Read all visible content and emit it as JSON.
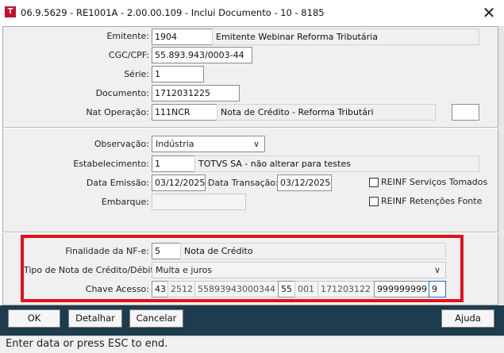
{
  "window": {
    "title": "06.9.5629 - RE1001A - 2.00.00.109 - Inclui Documento - 10 - 8185",
    "close_glyph": "✕",
    "app_icon_letter": "T"
  },
  "emitente": {
    "label": "Emitente:",
    "code": "1904",
    "name": "Emitente Webinar Reforma Tributária"
  },
  "cgc": {
    "label": "CGC/CPF:",
    "value": "55.893.943/0003-44"
  },
  "serie": {
    "label": "Série:",
    "value": "1"
  },
  "documento": {
    "label": "Documento:",
    "value": "1712031225"
  },
  "nat_operacao": {
    "label": "Nat Operação:",
    "code": "111NCR",
    "description": "Nota de Crédito - Reforma Tributári",
    "extra": ""
  },
  "observacao": {
    "label": "Observação:",
    "value": "Indústria"
  },
  "estabelecimento": {
    "label": "Estabelecimento:",
    "code": "1",
    "name": "TOTVS SA - não alterar para testes"
  },
  "data_emissao": {
    "label": "Data Emissão:",
    "value": "03/12/2025"
  },
  "data_transacao": {
    "label": "Data Transação:",
    "value": "03/12/2025"
  },
  "embarque": {
    "label": "Embarque:",
    "value": ""
  },
  "checkboxes": [
    {
      "label": "REINF Serviços Tomados",
      "checked": false
    },
    {
      "label": "REINF Retenções Fonte",
      "checked": false
    }
  ],
  "finalidade": {
    "label": "Finalidade da NF-e:",
    "code": "5",
    "description": "Nota de Crédito"
  },
  "tipo_nota": {
    "label": "Tipo de Nota de Crédito/Débito:",
    "value": "Multa e juros"
  },
  "chave_acesso": {
    "label": "Chave Acesso:",
    "parts": [
      "43",
      "2512",
      "55893943000344",
      "55",
      "001",
      "171203122",
      "999999999",
      "9"
    ]
  },
  "buttons": {
    "ok": "OK",
    "detalhar": "Detalhar",
    "cancelar": "Cancelar",
    "ajuda": "Ajuda"
  },
  "status_bar": "Enter data or press ESC to end.",
  "colors": {
    "highlight_border": "#e4101b",
    "button_bar": "#1d3c4d"
  }
}
